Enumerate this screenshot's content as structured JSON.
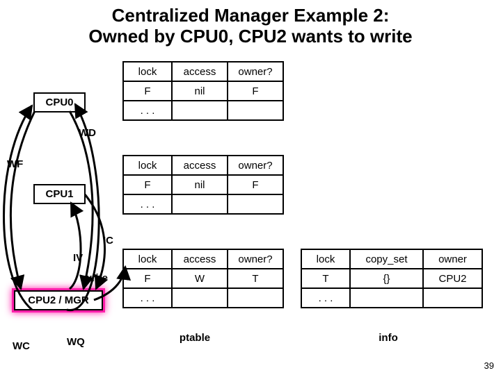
{
  "title_line1": "Centralized Manager Example 2:",
  "title_line2": "Owned by CPU0, CPU2 wants to write",
  "headers": {
    "lock": "lock",
    "access": "access",
    "owner": "owner?"
  },
  "info_headers": {
    "lock": "lock",
    "copyset": "copy_set",
    "owner": "owner"
  },
  "ellipsis": ". . .",
  "cpu0": {
    "name": "CPU0",
    "lock": "F",
    "access": "nil",
    "owner": "F"
  },
  "cpu1": {
    "name": "CPU1",
    "lock": "F",
    "access": "nil",
    "owner": "F"
  },
  "cpu2": {
    "name": "CPU2 / MGR",
    "lock": "F",
    "access": "W",
    "owner": "T"
  },
  "info": {
    "lock": "T",
    "copyset": "{}",
    "owner": "CPU2"
  },
  "captions": {
    "ptable": "ptable",
    "info": "info"
  },
  "msgs": {
    "WD": "WD",
    "WF": "WF",
    "IC": "IC",
    "IV": "IV",
    "write": "write",
    "WC": "WC",
    "WQ": "WQ"
  },
  "slidenum": "39"
}
